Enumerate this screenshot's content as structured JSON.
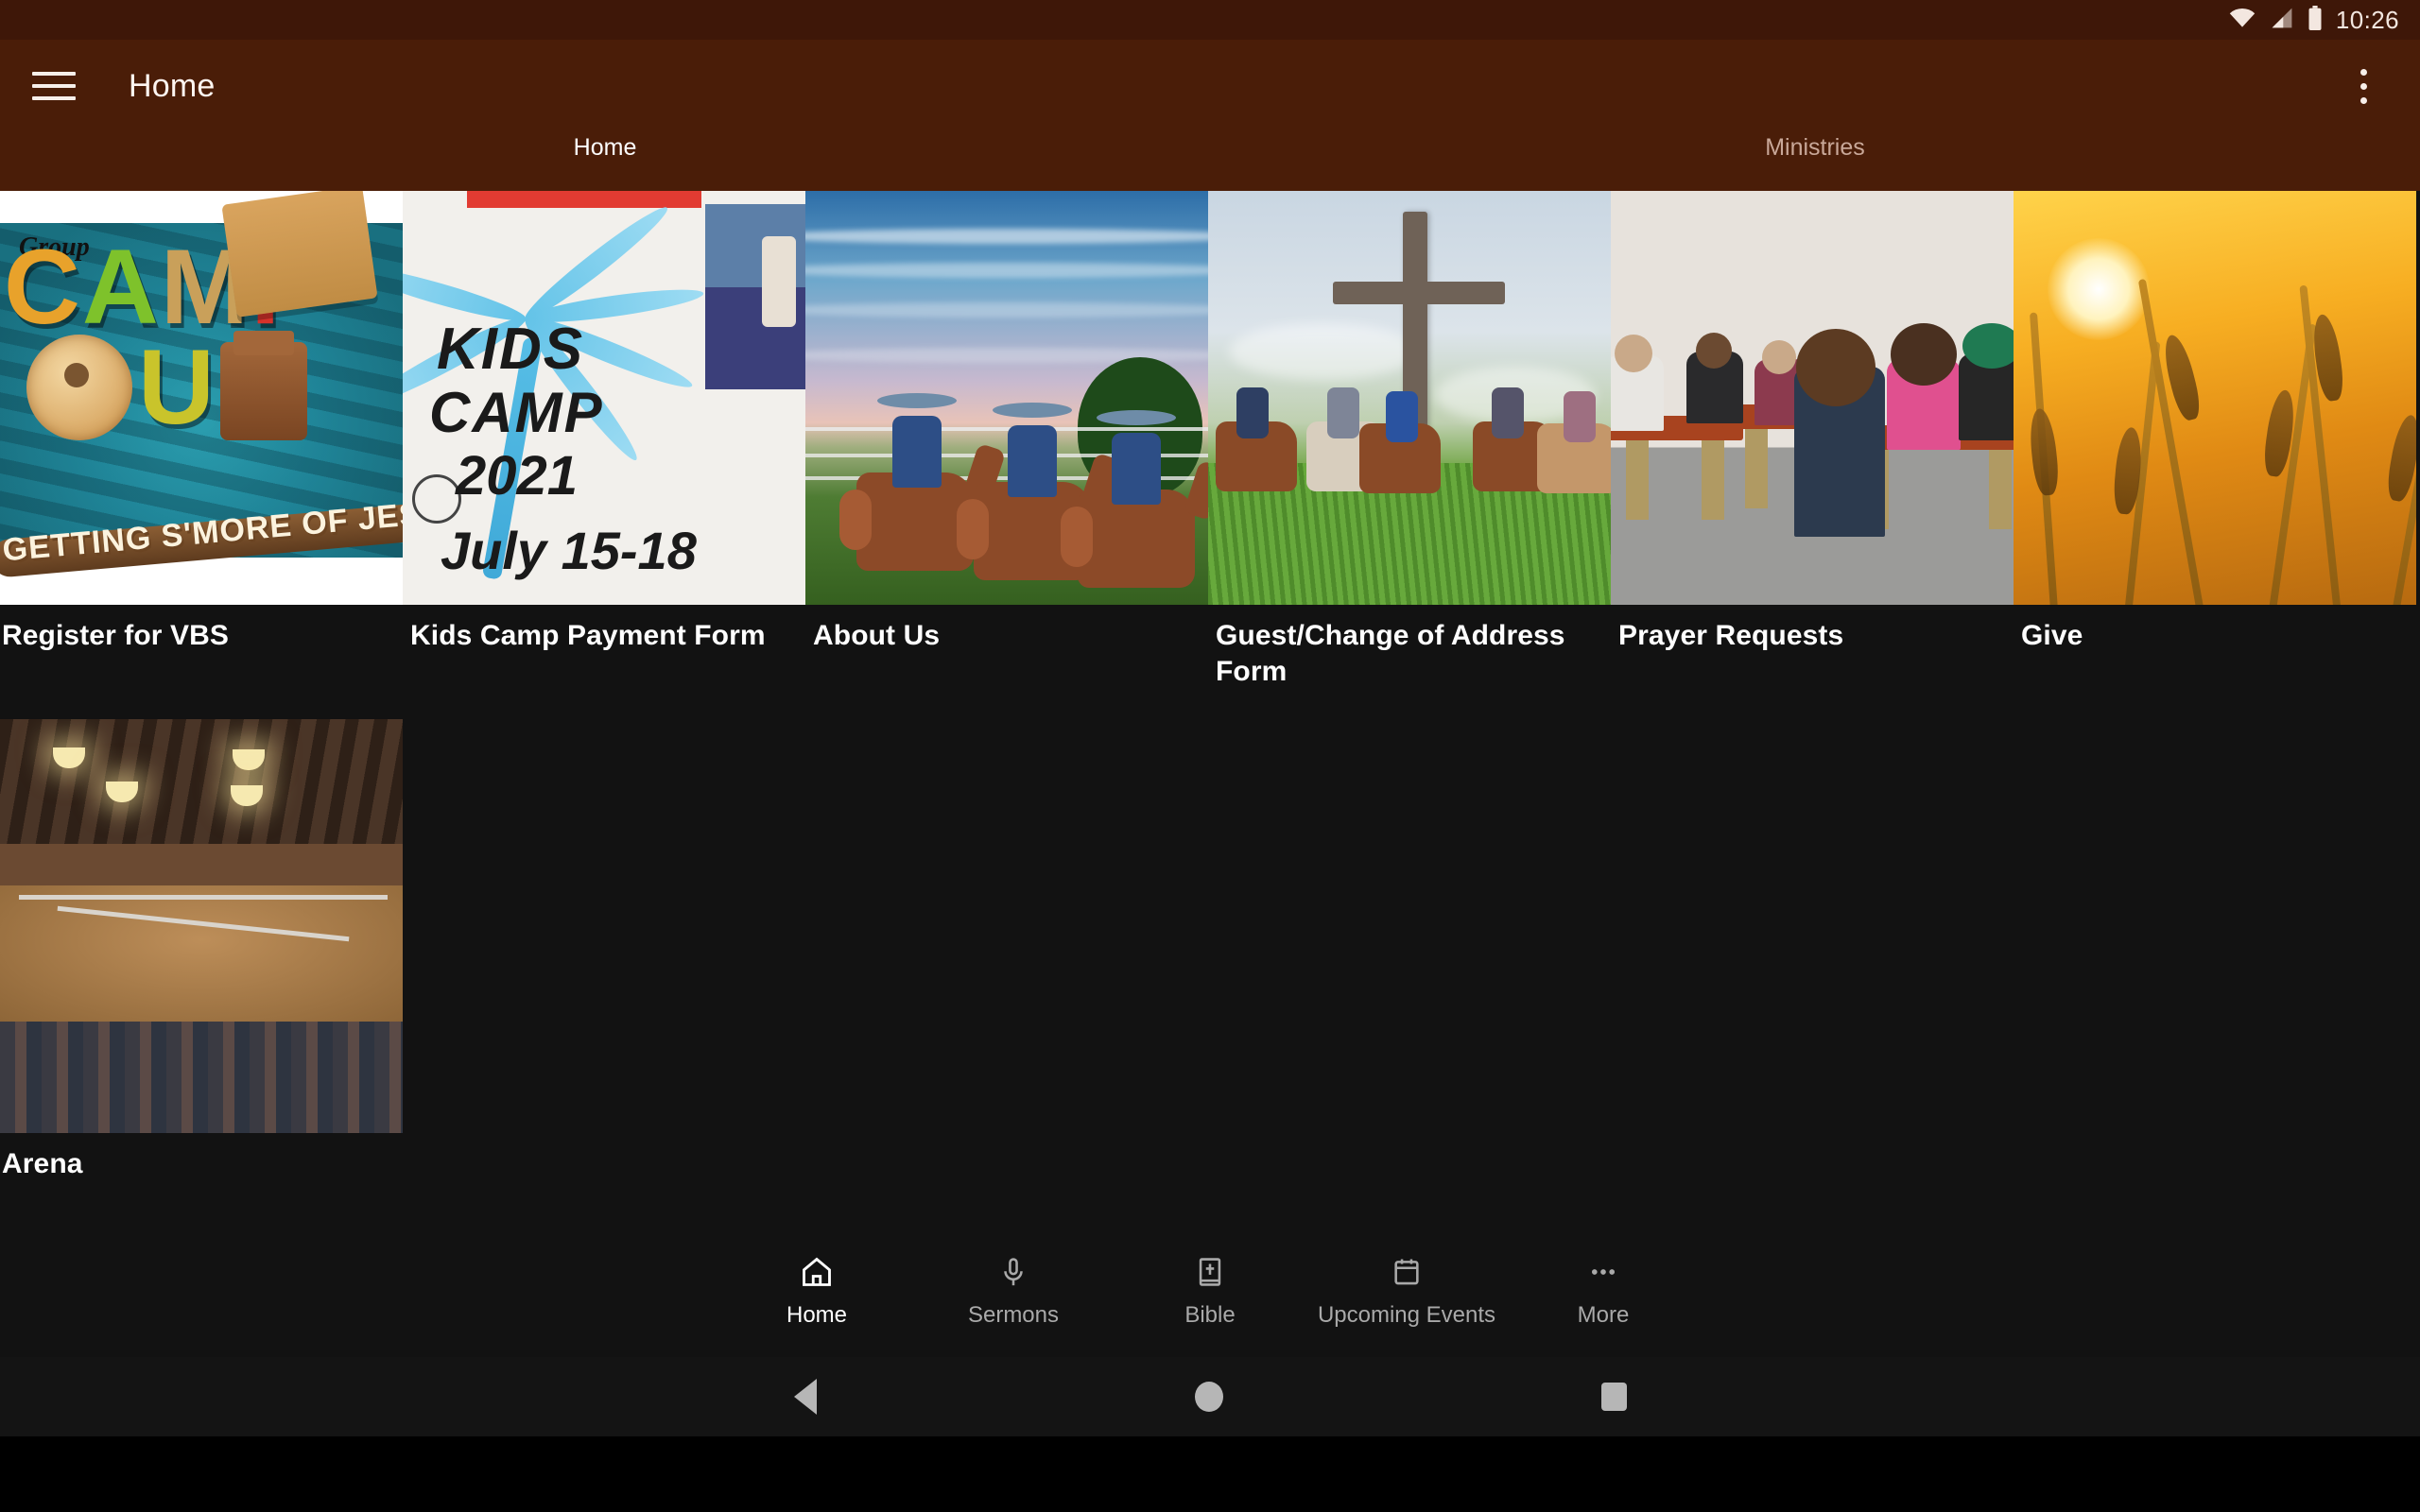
{
  "status_bar": {
    "time": "10:26",
    "icons": [
      "wifi-icon",
      "cellular-signal-icon",
      "battery-icon"
    ]
  },
  "app_bar": {
    "menu_icon": "hamburger-menu-icon",
    "title": "Home",
    "overflow_icon": "overflow-menu-icon"
  },
  "tabs": [
    {
      "label": "Home",
      "active": true
    },
    {
      "label": "Ministries",
      "active": false
    }
  ],
  "cards": [
    {
      "label": "Register for VBS",
      "image": "vbs-camp-out-poster",
      "image_text": {
        "brand": "Group",
        "title1": "CAMP",
        "title2": "OUT",
        "tagline": "GETTING S'MORE OF JESUS"
      }
    },
    {
      "label": "Kids Camp Payment Form",
      "image": "kids-camp-2021-flyer",
      "image_text": {
        "line1": "KIDS",
        "line2": "CAMP",
        "line3": "2021",
        "line4": "July 15-18"
      }
    },
    {
      "label": "About Us",
      "image": "cowboys-riding-at-dusk-photo"
    },
    {
      "label": "Guest/Change of Address Form",
      "image": "wooden-cross-with-riders-photo"
    },
    {
      "label": "Prayer Requests",
      "image": "children-praying-at-benches-photo"
    },
    {
      "label": "Give",
      "image": "golden-wheat-field-sunset-photo"
    },
    {
      "label": "Arena",
      "image": "indoor-rodeo-arena-photo"
    }
  ],
  "bottom_nav": [
    {
      "label": "Home",
      "icon": "home-icon",
      "active": true
    },
    {
      "label": "Sermons",
      "icon": "microphone-icon",
      "active": false
    },
    {
      "label": "Bible",
      "icon": "bible-book-icon",
      "active": false
    },
    {
      "label": "Upcoming Events",
      "icon": "calendar-icon",
      "active": false
    },
    {
      "label": "More",
      "icon": "more-dots-icon",
      "active": false
    }
  ],
  "system_nav": {
    "back": "back-button",
    "home": "home-button",
    "recents": "recents-button"
  },
  "colors": {
    "app_bar": "#4A1D08",
    "status_bar": "#3E1708",
    "content_bg": "#121212",
    "tab_active": "#FFFFFF",
    "tab_inactive": "#C9A899"
  }
}
